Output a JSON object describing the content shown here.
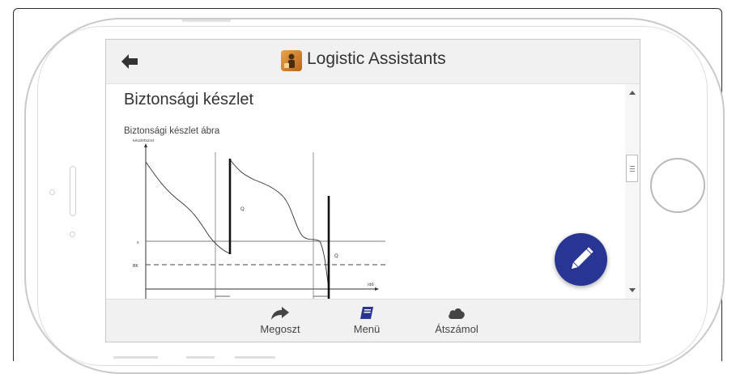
{
  "app": {
    "title": "Logistic Assistants",
    "icon": "app-logo-icon"
  },
  "header": {
    "back_icon": "arrow-left-icon"
  },
  "page": {
    "title": "Biztonsági készlet",
    "figure_caption": "Biztonsági készlet ábra"
  },
  "figure": {
    "y_axis_label": "készletszint",
    "x_axis_label": "idő",
    "q_label_1": "Q",
    "q_label_2": "Q",
    "level_label": "s",
    "safety_stock_label": "BK"
  },
  "fab": {
    "icon": "pencil-icon",
    "color": "#283593"
  },
  "footer": {
    "items": [
      {
        "label": "Megoszt",
        "icon": "share-icon"
      },
      {
        "label": "Menü",
        "icon": "book-icon",
        "color": "#283593"
      },
      {
        "label": "Átszámol",
        "icon": "cloud-icon"
      }
    ]
  }
}
